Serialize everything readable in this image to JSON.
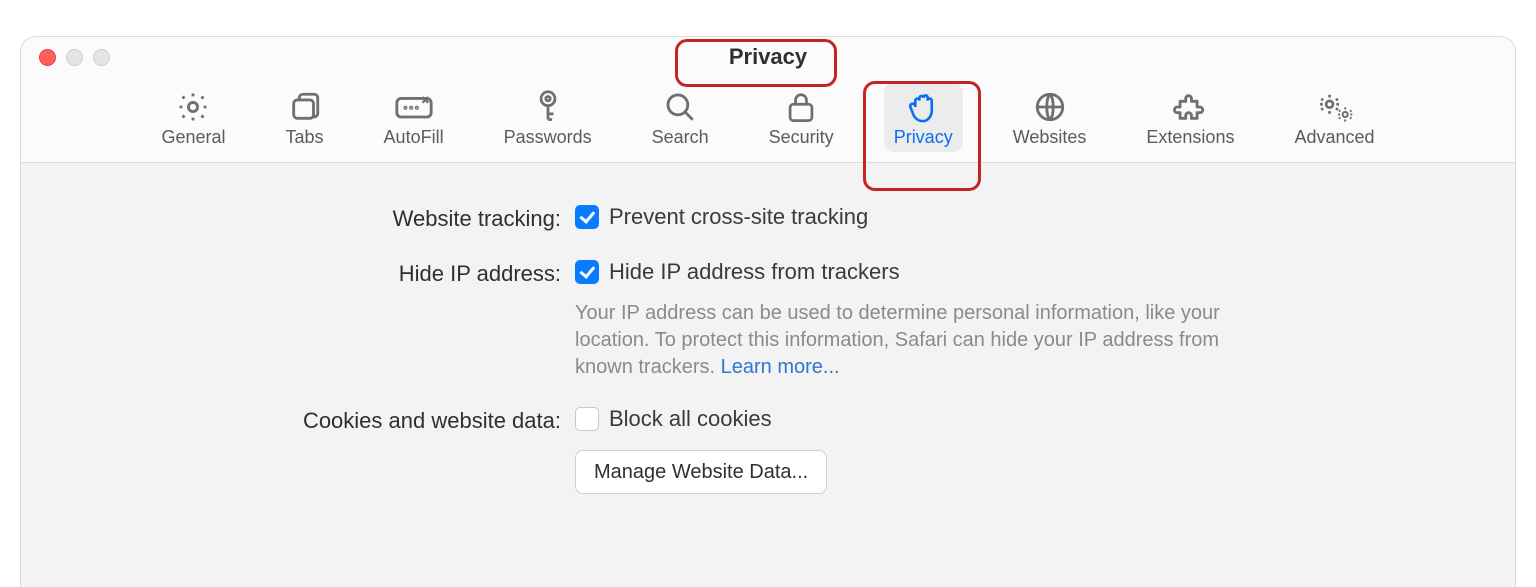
{
  "window": {
    "title": "Privacy"
  },
  "toolbar": {
    "active_index": 6,
    "tabs": [
      {
        "id": "general",
        "label": "General"
      },
      {
        "id": "tabs",
        "label": "Tabs"
      },
      {
        "id": "autofill",
        "label": "AutoFill"
      },
      {
        "id": "passwords",
        "label": "Passwords"
      },
      {
        "id": "search",
        "label": "Search"
      },
      {
        "id": "security",
        "label": "Security"
      },
      {
        "id": "privacy",
        "label": "Privacy"
      },
      {
        "id": "websites",
        "label": "Websites"
      },
      {
        "id": "extensions",
        "label": "Extensions"
      },
      {
        "id": "advanced",
        "label": "Advanced"
      }
    ]
  },
  "privacy": {
    "tracking": {
      "label": "Website tracking:",
      "prevent_cross_site": {
        "checked": true,
        "label": "Prevent cross-site tracking"
      }
    },
    "hide_ip": {
      "label": "Hide IP address:",
      "from_trackers": {
        "checked": true,
        "label": "Hide IP address from trackers"
      },
      "help": "Your IP address can be used to determine personal information, like your location. To protect this information, Safari can hide your IP address from known trackers. ",
      "learn_more": "Learn more..."
    },
    "cookies": {
      "label": "Cookies and website data:",
      "block_all": {
        "checked": false,
        "label": "Block all cookies"
      },
      "manage_button": "Manage Website Data..."
    }
  },
  "annotations": {
    "title_highlight": true,
    "privacy_tab_highlight": true
  },
  "colors": {
    "accent": "#0a7bff",
    "link": "#2f74d0",
    "highlight_box": "#c22525"
  }
}
